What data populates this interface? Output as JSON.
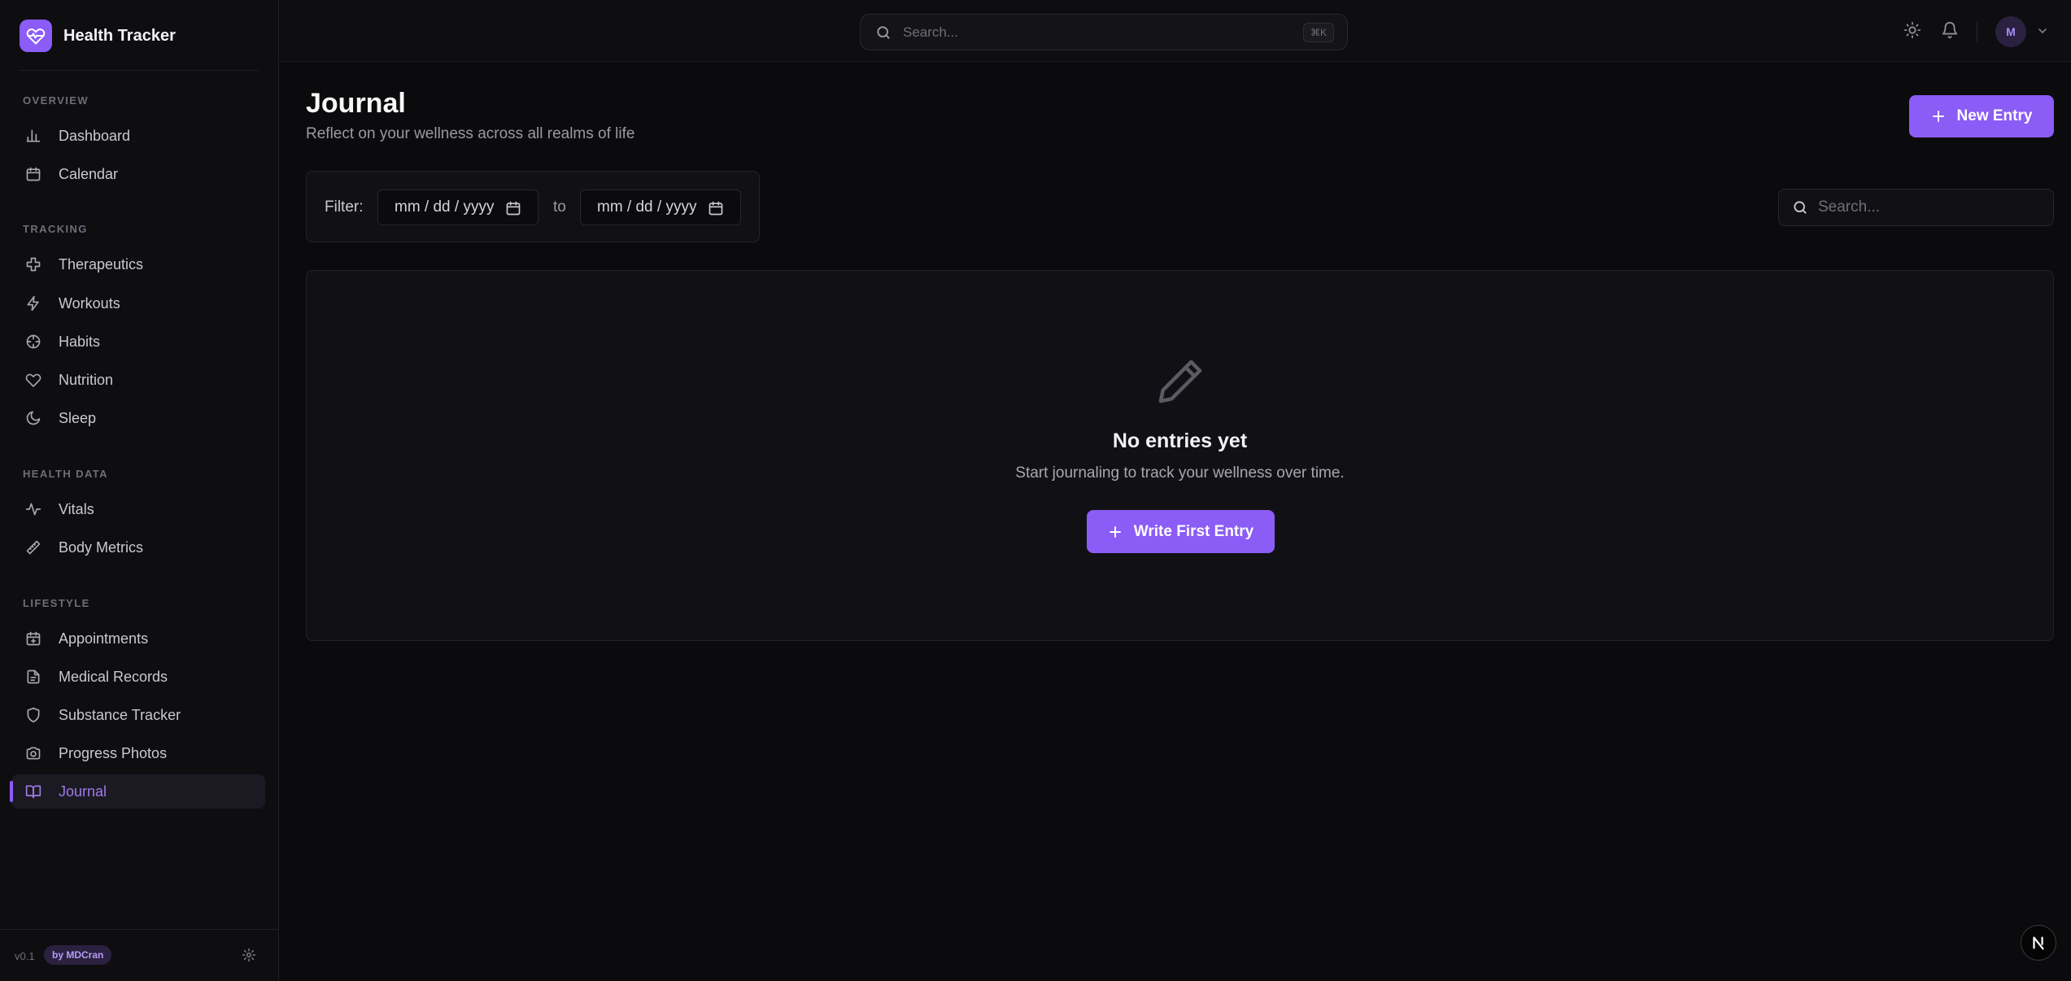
{
  "app": {
    "name": "Health Tracker"
  },
  "sidebar": {
    "sections": [
      {
        "title": "OVERVIEW",
        "items": [
          {
            "label": "Dashboard",
            "icon": "bar-chart-icon"
          },
          {
            "label": "Calendar",
            "icon": "calendar-icon"
          }
        ]
      },
      {
        "title": "TRACKING",
        "items": [
          {
            "label": "Therapeutics",
            "icon": "cross-icon"
          },
          {
            "label": "Workouts",
            "icon": "lightning-icon"
          },
          {
            "label": "Habits",
            "icon": "target-icon"
          },
          {
            "label": "Nutrition",
            "icon": "heart-icon"
          },
          {
            "label": "Sleep",
            "icon": "moon-icon"
          }
        ]
      },
      {
        "title": "HEALTH DATA",
        "items": [
          {
            "label": "Vitals",
            "icon": "pulse-icon"
          },
          {
            "label": "Body Metrics",
            "icon": "ruler-icon"
          }
        ]
      },
      {
        "title": "LIFESTYLE",
        "items": [
          {
            "label": "Appointments",
            "icon": "calendar-plus-icon"
          },
          {
            "label": "Medical Records",
            "icon": "document-icon"
          },
          {
            "label": "Substance Tracker",
            "icon": "shield-icon"
          },
          {
            "label": "Progress Photos",
            "icon": "camera-icon"
          },
          {
            "label": "Journal",
            "icon": "book-icon",
            "active": true
          }
        ]
      }
    ],
    "footer": {
      "version": "v0.1",
      "badge": "by MDCran"
    }
  },
  "topbar": {
    "search_placeholder": "Search...",
    "shortcut": "⌘K",
    "avatar_initial": "M"
  },
  "page": {
    "title": "Journal",
    "subtitle": "Reflect on your wellness across all realms of life",
    "new_entry_label": "New Entry"
  },
  "filter": {
    "label": "Filter:",
    "from_placeholder": "mm / dd / yyyy",
    "to_label": "to",
    "to_placeholder": "mm / dd / yyyy"
  },
  "list_search": {
    "placeholder": "Search..."
  },
  "empty_state": {
    "title": "No entries yet",
    "subtitle": "Start journaling to track your wellness over time.",
    "button_label": "Write First Entry"
  },
  "colors": {
    "accent": "#8b5cf6",
    "background": "#0b0b0d",
    "sidebar": "#0e0e11",
    "card": "#111115"
  }
}
